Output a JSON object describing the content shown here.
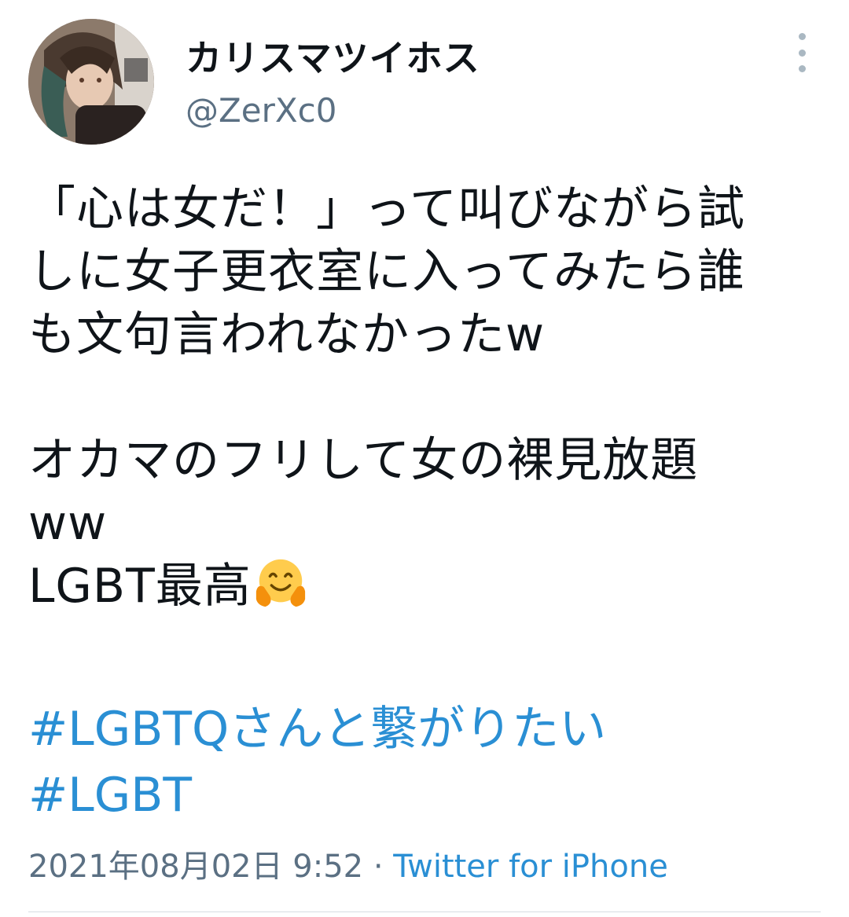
{
  "user": {
    "display_name": "カリスマツイホス",
    "handle": "@ZerXc0"
  },
  "tweet": {
    "lines": [
      "「心は女だ！」って叫びながら試",
      "しに女子更衣室に入ってみたら誰",
      "も文句言われなかったw",
      "",
      "オカマのフリして女の裸見放題",
      "ww",
      "LGBT最高"
    ],
    "emoji": "hugging-face",
    "hashtags": [
      "#LGBTQさんと繋がりたい",
      "#LGBT"
    ]
  },
  "meta": {
    "timestamp": "2021年08月02日 9:52",
    "separator": " · ",
    "source": "Twitter for iPhone"
  },
  "colors": {
    "link": "#2a8fd4",
    "secondary_text": "#5b7083",
    "primary_text": "#0f1419"
  }
}
